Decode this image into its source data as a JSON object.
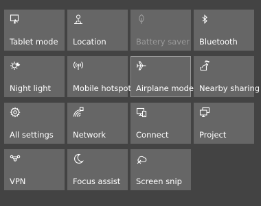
{
  "quick_actions": {
    "tiles": [
      {
        "label": "Tablet mode",
        "icon": "tablet-mode-icon"
      },
      {
        "label": "Location",
        "icon": "location-icon"
      },
      {
        "label": "Battery saver",
        "icon": "battery-saver-icon",
        "state": "disabled"
      },
      {
        "label": "Bluetooth",
        "icon": "bluetooth-icon"
      },
      {
        "label": "Night light",
        "icon": "night-light-icon"
      },
      {
        "label": "Mobile hotspot",
        "icon": "mobile-hotspot-icon"
      },
      {
        "label": "Airplane mode",
        "icon": "airplane-icon",
        "state": "selected"
      },
      {
        "label": "Nearby sharing",
        "icon": "nearby-sharing-icon"
      },
      {
        "label": "All settings",
        "icon": "gear-icon"
      },
      {
        "label": "Network",
        "icon": "network-icon"
      },
      {
        "label": "Connect",
        "icon": "connect-icon"
      },
      {
        "label": "Project",
        "icon": "project-icon"
      },
      {
        "label": "VPN",
        "icon": "vpn-icon"
      },
      {
        "label": "Focus assist",
        "icon": "moon-icon"
      },
      {
        "label": "Screen snip",
        "icon": "screen-snip-icon"
      }
    ]
  },
  "colors": {
    "panel_background": "#434343",
    "tile_background": "#666666",
    "text": "#ffffff",
    "disabled_text": "#9a9a9a"
  }
}
